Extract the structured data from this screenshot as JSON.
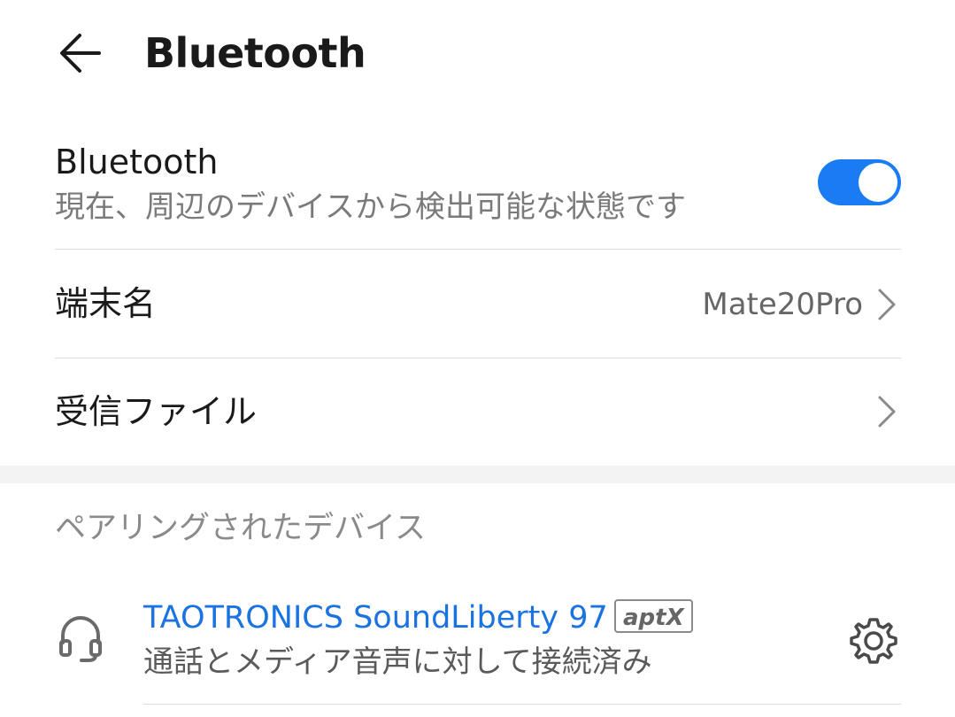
{
  "header": {
    "title": "Bluetooth",
    "back_icon": "arrow-left-icon"
  },
  "bluetooth_row": {
    "title": "Bluetooth",
    "subtitle": "現在、周辺のデバイスから検出可能な状態です",
    "toggle_on": true,
    "accent_color": "#1a7cf2"
  },
  "device_name_row": {
    "label": "端末名",
    "value": "Mate20Pro"
  },
  "received_files_row": {
    "label": "受信ファイル"
  },
  "paired_section": {
    "label": "ペアリングされたデバイス",
    "devices": [
      {
        "name": "TAOTRONICS SoundLiberty 97",
        "badge": "aptX",
        "status": "通話とメディア音声に対して接続済み",
        "icon": "headset-icon",
        "settings_icon": "gear-icon"
      }
    ]
  }
}
